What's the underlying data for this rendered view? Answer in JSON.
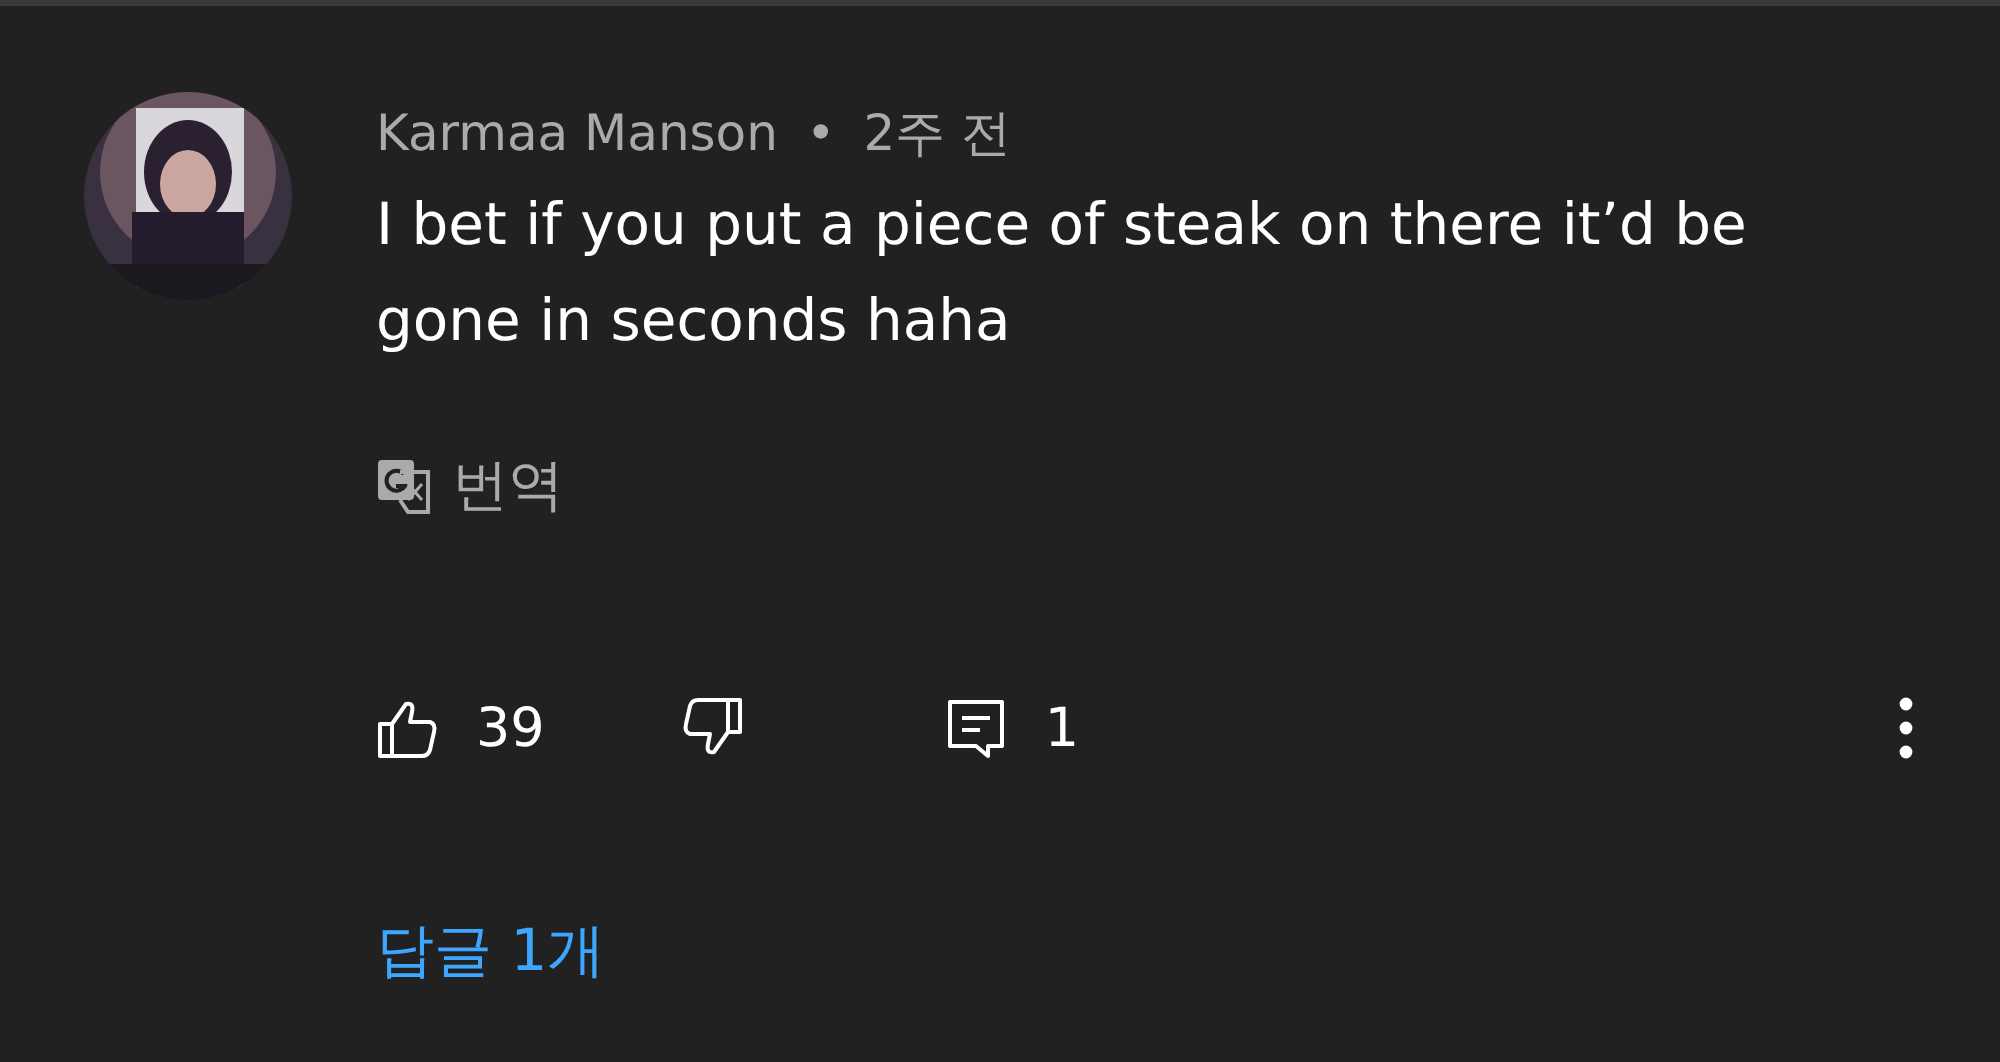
{
  "comment": {
    "author": "Karmaa Manson",
    "separator": "•",
    "time": "2주 전",
    "text": "I bet if you put a piece of steak on there it’d be gone in seconds haha"
  },
  "translate": {
    "label": "번역"
  },
  "actions": {
    "likes": "39",
    "replies_count": "1"
  },
  "replies_link": "답글 1개"
}
